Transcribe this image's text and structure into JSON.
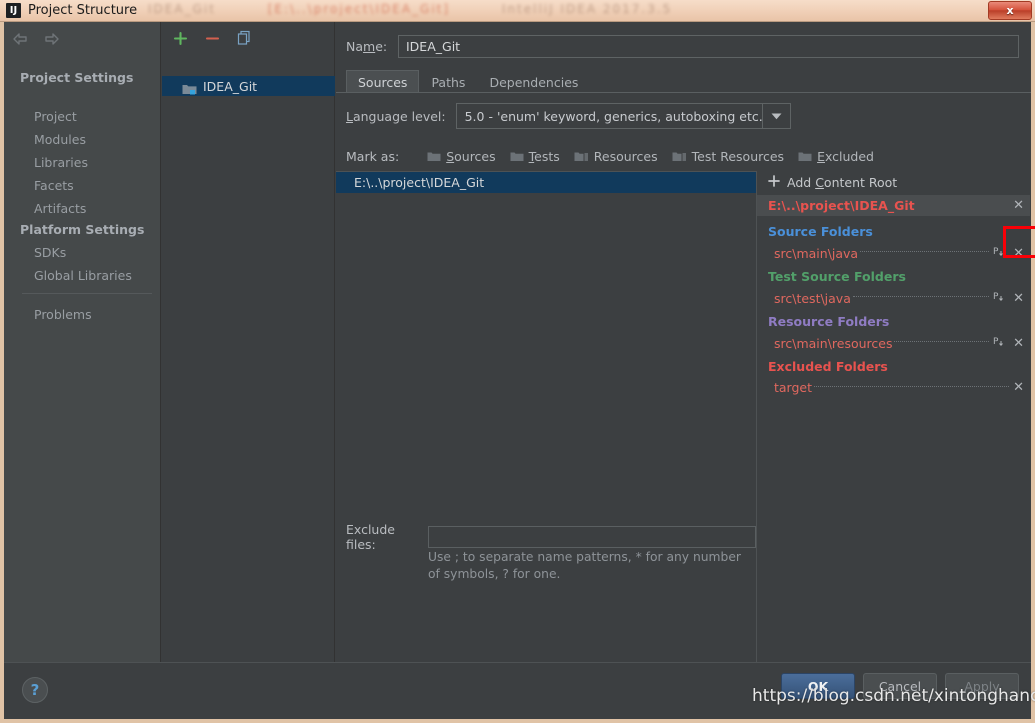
{
  "window": {
    "title": "Project Structure",
    "app_icon": "IJ",
    "close_label": "x",
    "ghost_segments": [
      "IDEA_Git",
      "[E:\\..\\project\\IDEA_Git]",
      "IntelliJ IDEA 2017.3.5"
    ]
  },
  "nav": {
    "back_icon": "arrow-left-icon",
    "forward_icon": "arrow-right-icon"
  },
  "sidebar": {
    "groups": [
      {
        "label": "Project Settings",
        "items": [
          "Project",
          "Modules",
          "Libraries",
          "Facets",
          "Artifacts"
        ]
      },
      {
        "label": "Platform Settings",
        "items": [
          "SDKs",
          "Global Libraries"
        ]
      }
    ],
    "extra": "Problems"
  },
  "modules": {
    "toolbar": {
      "add": "+",
      "remove": "−",
      "copy": "copy-icon"
    },
    "items": [
      {
        "label": "IDEA_Git",
        "selected": true
      }
    ]
  },
  "detail": {
    "name_label": "Name:",
    "name_value": "IDEA_Git",
    "tabs": [
      {
        "label": "Sources",
        "selected": true
      },
      {
        "label": "Paths",
        "selected": false
      },
      {
        "label": "Dependencies",
        "selected": false
      }
    ],
    "language_level_label": "Language level:",
    "language_level_value": "5.0 - 'enum' keyword, generics, autoboxing etc.",
    "mark_as_label": "Mark as:",
    "mark_as_options": [
      "Sources",
      "Tests",
      "Resources",
      "Test Resources",
      "Excluded"
    ],
    "tree_rows": [
      {
        "label": "E:\\..\\project\\IDEA_Git",
        "selected": true
      }
    ],
    "exclude_files_label": "Exclude files:",
    "exclude_files_value": "",
    "exclude_hint": "Use ; to separate name patterns, * for any number of symbols, ? for one."
  },
  "roots": {
    "add_content_root": "Add Content Root",
    "add_icon": "plus-icon",
    "content_root": "E:\\..\\project\\IDEA_Git",
    "content_root_remove_icon": "close-icon",
    "groups": [
      {
        "label": "Source Folders",
        "color": "#4a90d9",
        "entries": [
          {
            "path": "src\\main\\java",
            "has_prefix_icon": true
          }
        ]
      },
      {
        "label": "Test Source Folders",
        "color": "#52a06a",
        "entries": [
          {
            "path": "src\\test\\java",
            "has_prefix_icon": true
          }
        ]
      },
      {
        "label": "Resource Folders",
        "color": "#8f7cc3",
        "entries": [
          {
            "path": "src\\main\\resources",
            "has_prefix_icon": true
          }
        ]
      },
      {
        "label": "Excluded Folders",
        "color": "#e8534f",
        "entries": [
          {
            "path": "target",
            "has_prefix_icon": false
          }
        ]
      }
    ],
    "prefix_icon_label": "P",
    "remove_icon_label": "✕"
  },
  "footer": {
    "help_label": "?",
    "ok": "OK",
    "cancel": "Cancel",
    "apply": "Apply",
    "watermark": "https://blog.csdn.net/xintonghanchuang"
  },
  "colors": {
    "dialog_bg": "#3c3f41",
    "sidebar_bg": "#45494a",
    "selection": "#113a5c",
    "titlebar": "#f1d2ba",
    "annotation_red": "#fb0007",
    "path_red": "#e0685f"
  }
}
